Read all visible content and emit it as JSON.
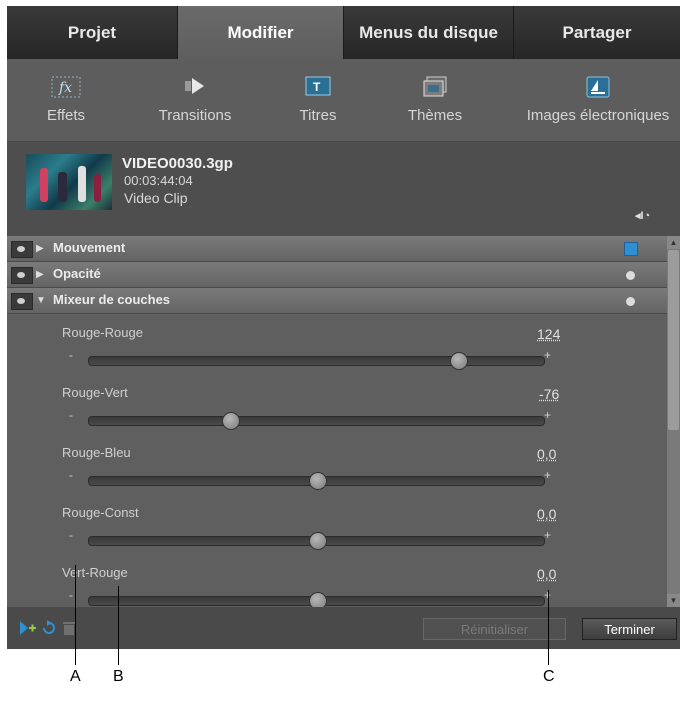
{
  "tabs": [
    {
      "label": "Projet"
    },
    {
      "label": "Modifier"
    },
    {
      "label": "Menus du disque"
    },
    {
      "label": "Partager"
    }
  ],
  "toolbar": [
    {
      "label": "Effets",
      "icon": "fx-icon"
    },
    {
      "label": "Transitions",
      "icon": "transitions-icon"
    },
    {
      "label": "Titres",
      "icon": "titles-icon"
    },
    {
      "label": "Thèmes",
      "icon": "themes-icon"
    },
    {
      "label": "Images électroniques",
      "icon": "clip-art-icon"
    }
  ],
  "clip": {
    "name": "VIDEO0030.3gp",
    "duration": "00:03:44:04",
    "type": "Video Clip",
    "keyframe_glyph": "◂I◔"
  },
  "effects": [
    {
      "name": "Mouvement",
      "expanded": false,
      "glyph": "▶"
    },
    {
      "name": "Opacité",
      "expanded": false,
      "glyph": "▶"
    },
    {
      "name": "Mixeur de couches",
      "expanded": true,
      "glyph": "▼"
    }
  ],
  "params": [
    {
      "label": "Rouge-Rouge",
      "value": "124",
      "level": 0.81
    },
    {
      "label": "Rouge-Vert",
      "value": "-76",
      "level": 0.31
    },
    {
      "label": "Rouge-Bleu",
      "value": "0,0",
      "level": 0.5
    },
    {
      "label": "Rouge-Const",
      "value": "0,0",
      "level": 0.5
    },
    {
      "label": "Vert-Rouge",
      "value": "0,0",
      "level": 0.5
    }
  ],
  "slider_signs": {
    "minus": "-",
    "plus": "+"
  },
  "buttons": {
    "reset": "Réinitialiser",
    "done": "Terminer"
  },
  "callouts": {
    "a": "A",
    "b": "B",
    "c": "C"
  },
  "colors": {
    "accent": "#2f8fd0",
    "panel": "#5a5a5a"
  }
}
